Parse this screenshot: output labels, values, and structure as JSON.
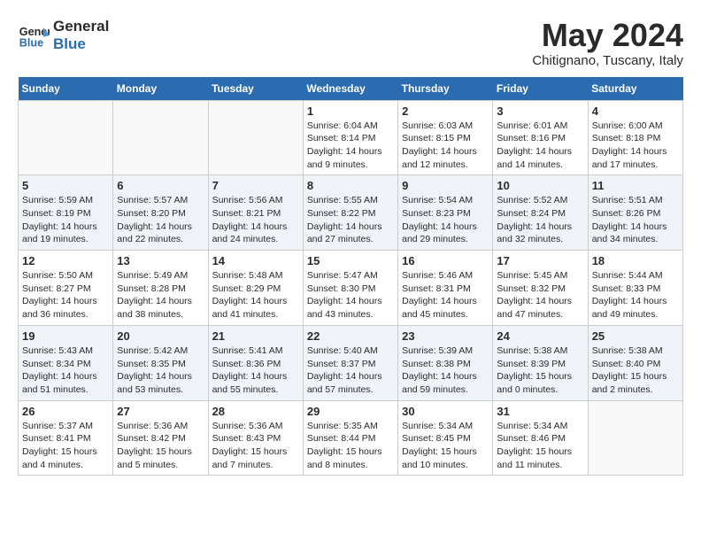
{
  "header": {
    "logo_general": "General",
    "logo_blue": "Blue",
    "month_title": "May 2024",
    "subtitle": "Chitignano, Tuscany, Italy"
  },
  "days_of_week": [
    "Sunday",
    "Monday",
    "Tuesday",
    "Wednesday",
    "Thursday",
    "Friday",
    "Saturday"
  ],
  "weeks": [
    [
      {
        "day": "",
        "info": ""
      },
      {
        "day": "",
        "info": ""
      },
      {
        "day": "",
        "info": ""
      },
      {
        "day": "1",
        "info": "Sunrise: 6:04 AM\nSunset: 8:14 PM\nDaylight: 14 hours\nand 9 minutes."
      },
      {
        "day": "2",
        "info": "Sunrise: 6:03 AM\nSunset: 8:15 PM\nDaylight: 14 hours\nand 12 minutes."
      },
      {
        "day": "3",
        "info": "Sunrise: 6:01 AM\nSunset: 8:16 PM\nDaylight: 14 hours\nand 14 minutes."
      },
      {
        "day": "4",
        "info": "Sunrise: 6:00 AM\nSunset: 8:18 PM\nDaylight: 14 hours\nand 17 minutes."
      }
    ],
    [
      {
        "day": "5",
        "info": "Sunrise: 5:59 AM\nSunset: 8:19 PM\nDaylight: 14 hours\nand 19 minutes."
      },
      {
        "day": "6",
        "info": "Sunrise: 5:57 AM\nSunset: 8:20 PM\nDaylight: 14 hours\nand 22 minutes."
      },
      {
        "day": "7",
        "info": "Sunrise: 5:56 AM\nSunset: 8:21 PM\nDaylight: 14 hours\nand 24 minutes."
      },
      {
        "day": "8",
        "info": "Sunrise: 5:55 AM\nSunset: 8:22 PM\nDaylight: 14 hours\nand 27 minutes."
      },
      {
        "day": "9",
        "info": "Sunrise: 5:54 AM\nSunset: 8:23 PM\nDaylight: 14 hours\nand 29 minutes."
      },
      {
        "day": "10",
        "info": "Sunrise: 5:52 AM\nSunset: 8:24 PM\nDaylight: 14 hours\nand 32 minutes."
      },
      {
        "day": "11",
        "info": "Sunrise: 5:51 AM\nSunset: 8:26 PM\nDaylight: 14 hours\nand 34 minutes."
      }
    ],
    [
      {
        "day": "12",
        "info": "Sunrise: 5:50 AM\nSunset: 8:27 PM\nDaylight: 14 hours\nand 36 minutes."
      },
      {
        "day": "13",
        "info": "Sunrise: 5:49 AM\nSunset: 8:28 PM\nDaylight: 14 hours\nand 38 minutes."
      },
      {
        "day": "14",
        "info": "Sunrise: 5:48 AM\nSunset: 8:29 PM\nDaylight: 14 hours\nand 41 minutes."
      },
      {
        "day": "15",
        "info": "Sunrise: 5:47 AM\nSunset: 8:30 PM\nDaylight: 14 hours\nand 43 minutes."
      },
      {
        "day": "16",
        "info": "Sunrise: 5:46 AM\nSunset: 8:31 PM\nDaylight: 14 hours\nand 45 minutes."
      },
      {
        "day": "17",
        "info": "Sunrise: 5:45 AM\nSunset: 8:32 PM\nDaylight: 14 hours\nand 47 minutes."
      },
      {
        "day": "18",
        "info": "Sunrise: 5:44 AM\nSunset: 8:33 PM\nDaylight: 14 hours\nand 49 minutes."
      }
    ],
    [
      {
        "day": "19",
        "info": "Sunrise: 5:43 AM\nSunset: 8:34 PM\nDaylight: 14 hours\nand 51 minutes."
      },
      {
        "day": "20",
        "info": "Sunrise: 5:42 AM\nSunset: 8:35 PM\nDaylight: 14 hours\nand 53 minutes."
      },
      {
        "day": "21",
        "info": "Sunrise: 5:41 AM\nSunset: 8:36 PM\nDaylight: 14 hours\nand 55 minutes."
      },
      {
        "day": "22",
        "info": "Sunrise: 5:40 AM\nSunset: 8:37 PM\nDaylight: 14 hours\nand 57 minutes."
      },
      {
        "day": "23",
        "info": "Sunrise: 5:39 AM\nSunset: 8:38 PM\nDaylight: 14 hours\nand 59 minutes."
      },
      {
        "day": "24",
        "info": "Sunrise: 5:38 AM\nSunset: 8:39 PM\nDaylight: 15 hours\nand 0 minutes."
      },
      {
        "day": "25",
        "info": "Sunrise: 5:38 AM\nSunset: 8:40 PM\nDaylight: 15 hours\nand 2 minutes."
      }
    ],
    [
      {
        "day": "26",
        "info": "Sunrise: 5:37 AM\nSunset: 8:41 PM\nDaylight: 15 hours\nand 4 minutes."
      },
      {
        "day": "27",
        "info": "Sunrise: 5:36 AM\nSunset: 8:42 PM\nDaylight: 15 hours\nand 5 minutes."
      },
      {
        "day": "28",
        "info": "Sunrise: 5:36 AM\nSunset: 8:43 PM\nDaylight: 15 hours\nand 7 minutes."
      },
      {
        "day": "29",
        "info": "Sunrise: 5:35 AM\nSunset: 8:44 PM\nDaylight: 15 hours\nand 8 minutes."
      },
      {
        "day": "30",
        "info": "Sunrise: 5:34 AM\nSunset: 8:45 PM\nDaylight: 15 hours\nand 10 minutes."
      },
      {
        "day": "31",
        "info": "Sunrise: 5:34 AM\nSunset: 8:46 PM\nDaylight: 15 hours\nand 11 minutes."
      },
      {
        "day": "",
        "info": ""
      }
    ]
  ]
}
